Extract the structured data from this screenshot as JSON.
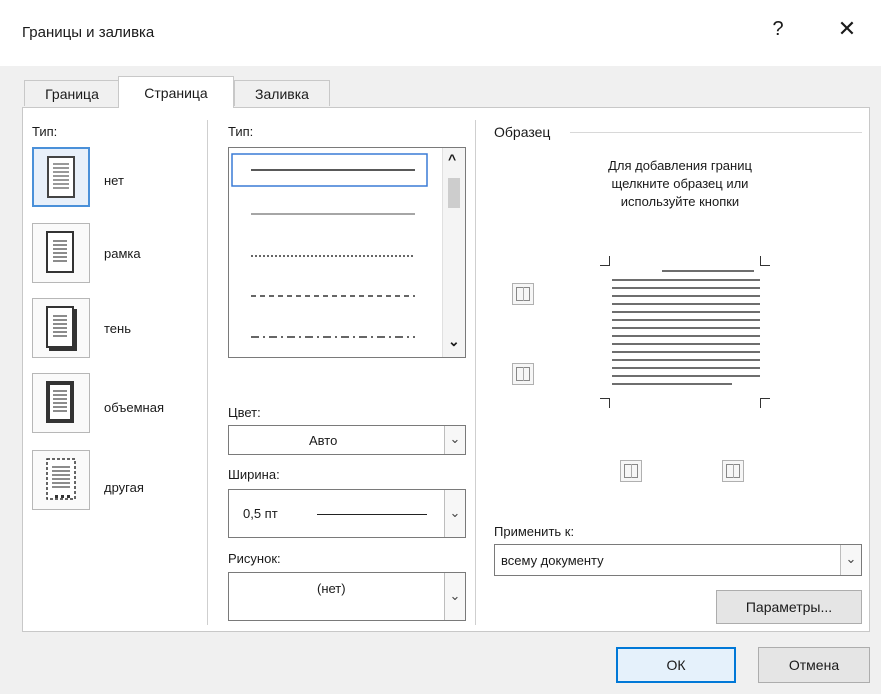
{
  "dialog": {
    "title": "Границы и заливка",
    "help_label": "?",
    "close_label": "✕"
  },
  "tabs": [
    {
      "label": "Граница",
      "active": false
    },
    {
      "label": "Страница",
      "active": true
    },
    {
      "label": "Заливка",
      "active": false
    }
  ],
  "setting": {
    "label": "Тип:",
    "items": [
      {
        "label": "нет",
        "selected": true
      },
      {
        "label": "рамка",
        "selected": false
      },
      {
        "label": "тень",
        "selected": false
      },
      {
        "label": "объемная",
        "selected": false
      },
      {
        "label": "другая",
        "selected": false
      }
    ]
  },
  "style": {
    "label": "Тип:",
    "scroll_up": "^",
    "scroll_down": "⌄"
  },
  "color": {
    "label": "Цвет:",
    "value": "Авто"
  },
  "width": {
    "label": "Ширина:",
    "value": "0,5 пт"
  },
  "art": {
    "label": "Рисунок:",
    "value": "(нет)"
  },
  "preview": {
    "label": "Образец",
    "hint_line1": "Для добавления границ",
    "hint_line2": "щелкните образец или",
    "hint_line3": "используйте кнопки"
  },
  "apply_to": {
    "label": "Применить к:",
    "value": "всему документу"
  },
  "buttons": {
    "options": "Параметры...",
    "ok": "ОК",
    "cancel": "Отмена"
  },
  "colors": {
    "accent": "#0078d7",
    "selection": "#4a90d9"
  }
}
